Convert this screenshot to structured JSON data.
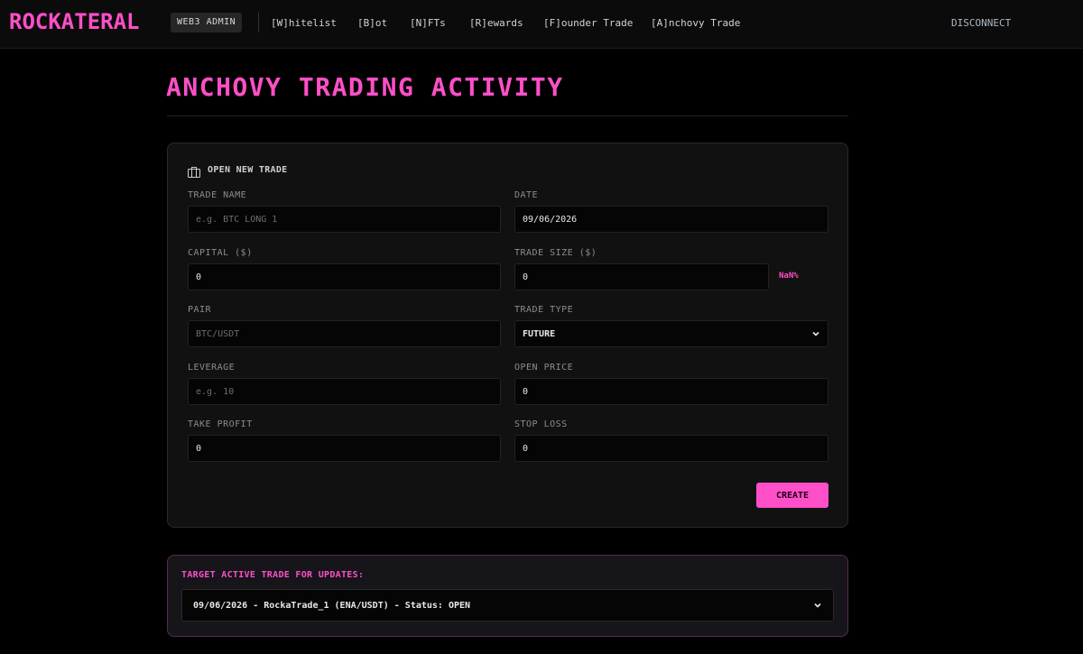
{
  "nav": {
    "logo": "ROCKATERAL",
    "badge": "WEB3 ADMIN",
    "links": [
      {
        "label": "[W]hitelist"
      },
      {
        "label": "[B]ot"
      },
      {
        "label": "[N]FTs"
      },
      {
        "label": "[R]ewards"
      },
      {
        "label": "[F]ounder Trade"
      },
      {
        "label": "[A]nchovy Trade"
      }
    ],
    "disconnect": "DISCONNECT"
  },
  "page": {
    "title": "ANCHOVY TRADING ACTIVITY"
  },
  "form": {
    "heading": "OPEN NEW TRADE",
    "heading_icon": "briefcase-icon",
    "trade_name": {
      "label": "TRADE NAME",
      "value": "",
      "placeholder": "e.g. BTC LONG 1"
    },
    "date": {
      "label": "DATE",
      "value": "09/06/2026"
    },
    "capital": {
      "label": "CAPITAL ($)",
      "value": "0"
    },
    "trade_size": {
      "label": "TRADE SIZE ($)",
      "value": "0",
      "percent": "NaN%"
    },
    "pair": {
      "label": "PAIR",
      "value": "",
      "placeholder": "BTC/USDT"
    },
    "trade_type": {
      "label": "TRADE TYPE",
      "value": "FUTURE"
    },
    "leverage": {
      "label": "LEVERAGE",
      "value": "",
      "placeholder": "e.g. 10"
    },
    "open_price": {
      "label": "OPEN PRICE",
      "value": "0"
    },
    "take_profit": {
      "label": "TAKE PROFIT",
      "value": "0"
    },
    "stop_loss": {
      "label": "STOP LOSS",
      "value": "0"
    },
    "create_label": "CREATE"
  },
  "target": {
    "label": "TARGET ACTIVE TRADE FOR UPDATES:",
    "selected": "09/06/2026 - RockaTrade_1 (ENA/USDT) - Status: OPEN"
  },
  "colors": {
    "accent": "#ff4fc8",
    "background": "#000000",
    "card": "#111111",
    "target_border": "#5a2a50"
  }
}
